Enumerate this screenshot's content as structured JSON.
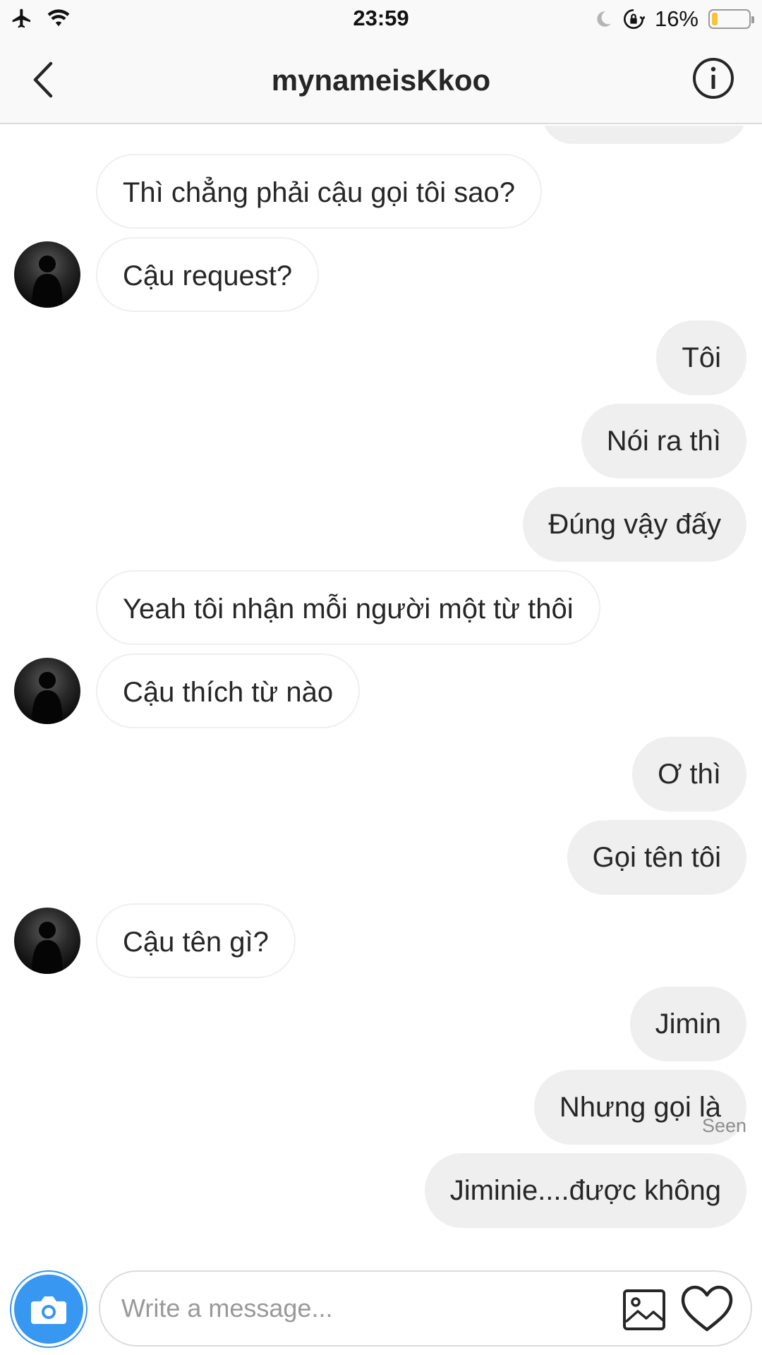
{
  "status_bar": {
    "time": "23:59",
    "battery_text": "16%",
    "battery_level": 0.16,
    "icons": [
      "airplane-mode-icon",
      "wifi-icon",
      "do-not-disturb-moon-icon",
      "orientation-lock-icon",
      "battery-icon"
    ]
  },
  "header": {
    "title": "mynameisKkoo",
    "back_icon": "chevron-left-icon",
    "info_icon": "info-circle-icon"
  },
  "messages": [
    {
      "direction": "in",
      "text": "Thì chẳng phải cậu gọi tôi sao?",
      "avatar": false
    },
    {
      "direction": "in",
      "text": "Cậu request?",
      "avatar": true
    },
    {
      "direction": "out",
      "text": "Tôi"
    },
    {
      "direction": "out",
      "text": "Nói ra thì"
    },
    {
      "direction": "out",
      "text": "Đúng vậy đấy"
    },
    {
      "direction": "in",
      "text": "Yeah tôi nhận mỗi người một từ thôi",
      "avatar": false
    },
    {
      "direction": "in",
      "text": "Cậu thích từ nào",
      "avatar": true
    },
    {
      "direction": "out",
      "text": "Ơ thì"
    },
    {
      "direction": "out",
      "text": "Gọi tên tôi"
    },
    {
      "direction": "in",
      "text": "Cậu tên gì?",
      "avatar": true
    },
    {
      "direction": "out",
      "text": "Jimin"
    },
    {
      "direction": "out",
      "text": "Nhưng gọi là"
    },
    {
      "direction": "out",
      "text": "Jiminie....được không"
    }
  ],
  "seen_label": "Seen",
  "composer": {
    "placeholder": "Write a message...",
    "value": "",
    "icons": [
      "camera-icon",
      "image-gallery-icon",
      "heart-icon"
    ]
  },
  "colors": {
    "accent_blue": "#3897f0",
    "outgoing_bubble": "#efefef",
    "incoming_border": "#efefef",
    "battery_low": "#f6c33b"
  }
}
